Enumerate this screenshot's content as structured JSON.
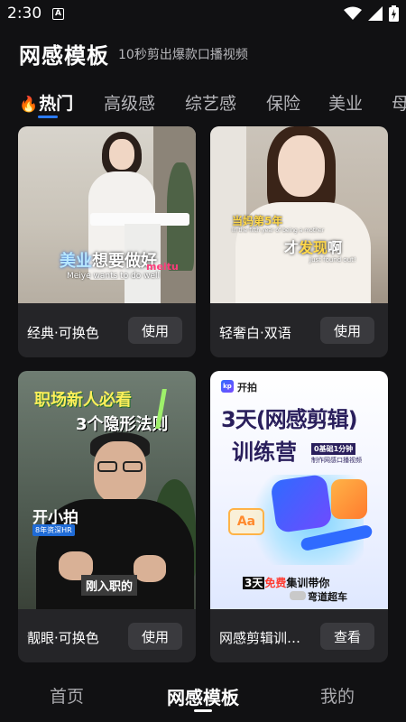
{
  "status_bar": {
    "time": "2:30",
    "notification_icon": "A"
  },
  "header": {
    "title": "网感模板",
    "subtitle": "10秒剪出爆款口播视频"
  },
  "tabs": [
    {
      "label": "热门",
      "icon": "fire-icon"
    },
    {
      "label": "高级感"
    },
    {
      "label": "综艺感"
    },
    {
      "label": "保险"
    },
    {
      "label": "美业"
    },
    {
      "label": "母"
    }
  ],
  "cards": [
    {
      "title": "经典·可换色",
      "button": "使用",
      "overlay": {
        "main_highlight": "美业",
        "main_rest": "想要做好",
        "english": "Meiye wants to do well",
        "brand": "meitu"
      }
    },
    {
      "title": "轻奢白·双语",
      "button": "使用",
      "overlay": {
        "line1": "当妈第5年",
        "line1_en": "In the fifth year of being a mother",
        "line2_pre": "才",
        "line2_highlight": "发现",
        "line2_post": "啊",
        "line2_en": "Just found out!"
      }
    },
    {
      "title": "靓眼·可换色",
      "button": "使用",
      "overlay": {
        "line1": "职场新人必看",
        "line2": "3个隐形法则",
        "name": "开小拍",
        "name_tag": "8年资深HR",
        "caption": "刚入职的"
      }
    },
    {
      "title": "网感剪辑训练营",
      "button": "查看",
      "overlay": {
        "app_name": "开拍",
        "logo": "kp",
        "line1": "3天(网感剪辑)",
        "line2": "训练营",
        "tag_line1": "0基础1分钟",
        "tag_line2": "制作网感口播视频",
        "aa": "Aa",
        "bottom_pre": "3天",
        "bottom_free": "免费",
        "bottom_post": "集训带你",
        "bottom_line2": "弯道超车"
      }
    }
  ],
  "bottom_nav": [
    {
      "label": "首页"
    },
    {
      "label": "网感模板",
      "active": true
    },
    {
      "label": "我的"
    }
  ],
  "colors": {
    "background": "#111113",
    "card": "#252528",
    "accent": "#2b7bff",
    "button": "#3a3a3e"
  }
}
